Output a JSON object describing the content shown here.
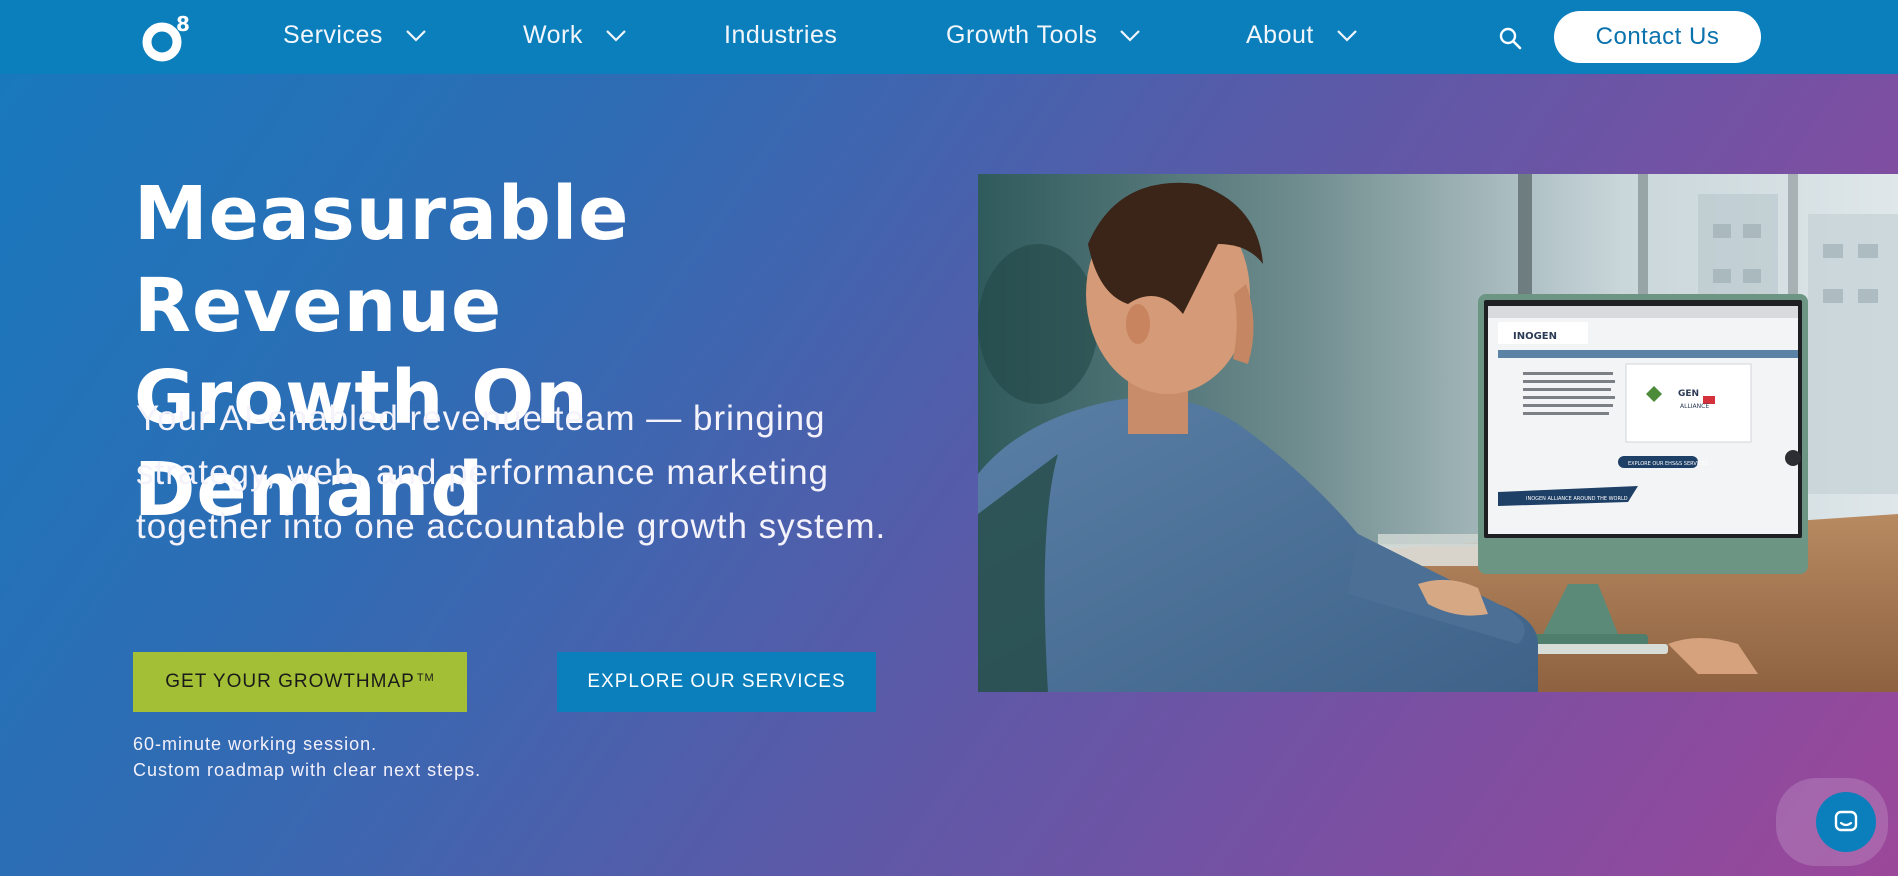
{
  "nav": {
    "logo_text": "O8",
    "items": [
      {
        "label": "Services",
        "has_dropdown": true
      },
      {
        "label": "Work",
        "has_dropdown": true
      },
      {
        "label": "Industries",
        "has_dropdown": false
      },
      {
        "label": "Growth Tools",
        "has_dropdown": true
      },
      {
        "label": "About",
        "has_dropdown": true
      }
    ],
    "search_icon": "search-icon",
    "contact_label": "Contact Us"
  },
  "hero": {
    "headline_line1": "Measurable Revenue",
    "headline_line2": "Growth On Demand",
    "subtext": "Your AI-enabled revenue team — bringing strategy, web, and performance marketing together into one accountable growth system.",
    "cta_primary_label": "GET YOUR GROWTHMAP",
    "cta_primary_mark": "TM",
    "cta_secondary_label": "EXPLORE OUR SERVICES",
    "note_line1": "60-minute working session.",
    "note_line2": "Custom roadmap with clear next steps."
  },
  "image": {
    "screen_logo": "INOGEN",
    "screen_logo_sub": "ALLIANCE",
    "screen_button": "EXPLORE OUR EHS&S SERVICES",
    "screen_banner": "INOGEN ALLIANCE AROUND THE WORLD"
  },
  "colors": {
    "nav_bg": "#0a7fbc",
    "primary_cta": "#a3bf35",
    "secondary_cta": "#0a7fbc",
    "gradient_start": "#1779bd",
    "gradient_end": "#9b479a"
  },
  "chat": {
    "icon": "chat-icon"
  }
}
